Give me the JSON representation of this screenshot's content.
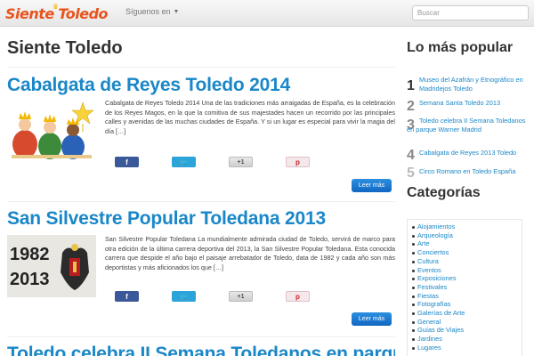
{
  "nav": {
    "brand_part1": "Siente",
    "brand_part2": "Toledo",
    "follow_label": "Síguenos en",
    "search_placeholder": "Buscar"
  },
  "main": {
    "page_title": "Siente Toledo",
    "posts": [
      {
        "title": "Cabalgata de Reyes Toledo 2014",
        "excerpt": "Cabalgata de Reyes Toledo 2014 Una de las tradiciones más arraigadas de España, es la celebración de los Reyes Magos, en la que la comitiva de sus majestades hacen un recorrido por las principales calles y avenidas de las muchas ciudades de España. Y si un lugar es especial para vivir la magia del día […]",
        "read_more": "Leer más"
      },
      {
        "title": "San Silvestre Popular Toledana 2013",
        "thumb_years": [
          "1982",
          "2013"
        ],
        "excerpt": "San Silvestre Popular Toledana La mundialmente admirada ciudad de Toledo, servirá de marco para otra edición de la última carrera deportiva del 2013, la San Silvestre Popular Toledana. Esta conocida carrera que despide el año bajo el paisaje arrebatador de Toledo, data de 1982 y cada año son más deportistas y más aficionados los que […]",
        "read_more": "Leer más"
      },
      {
        "title": "Toledo celebra II Semana Toledanos en parque"
      }
    ],
    "share": {
      "facebook": "f",
      "gplus": "+1",
      "pinterest": "p"
    }
  },
  "sidebar": {
    "popular_title": "Lo más popular",
    "popular": [
      {
        "num": "1",
        "label": "Museo del Azafrán y Etnográfico en Madridejos Toledo"
      },
      {
        "num": "2",
        "label": "Semana Santa Toledo 2013"
      },
      {
        "num": "3",
        "label": "Toledo celebra II Semana Toledanos en parque Warner Madrid"
      },
      {
        "num": "4",
        "label": "Cabalgata de Reyes 2013 Toledo"
      },
      {
        "num": "5",
        "label": "Circo Romano en Toledo España"
      }
    ],
    "categories_title": "Categorías",
    "categories": [
      "Alojamientos",
      "Arqueología",
      "Arte",
      "Conciertos",
      "Cultura",
      "Eventos",
      "Exposiciones",
      "Festivales",
      "Fiestas",
      "Fotografías",
      "Galerías de Arte",
      "General",
      "Guías de Viajes",
      "Jardines",
      "Lugares"
    ]
  },
  "colors": {
    "link": "#1a87c8",
    "brand": "#e8541e",
    "button": "#1167c2"
  },
  "icons": [
    "caret-down-icon",
    "facebook-icon",
    "twitter-icon",
    "gplus-icon",
    "pinterest-icon",
    "crown-icon"
  ]
}
